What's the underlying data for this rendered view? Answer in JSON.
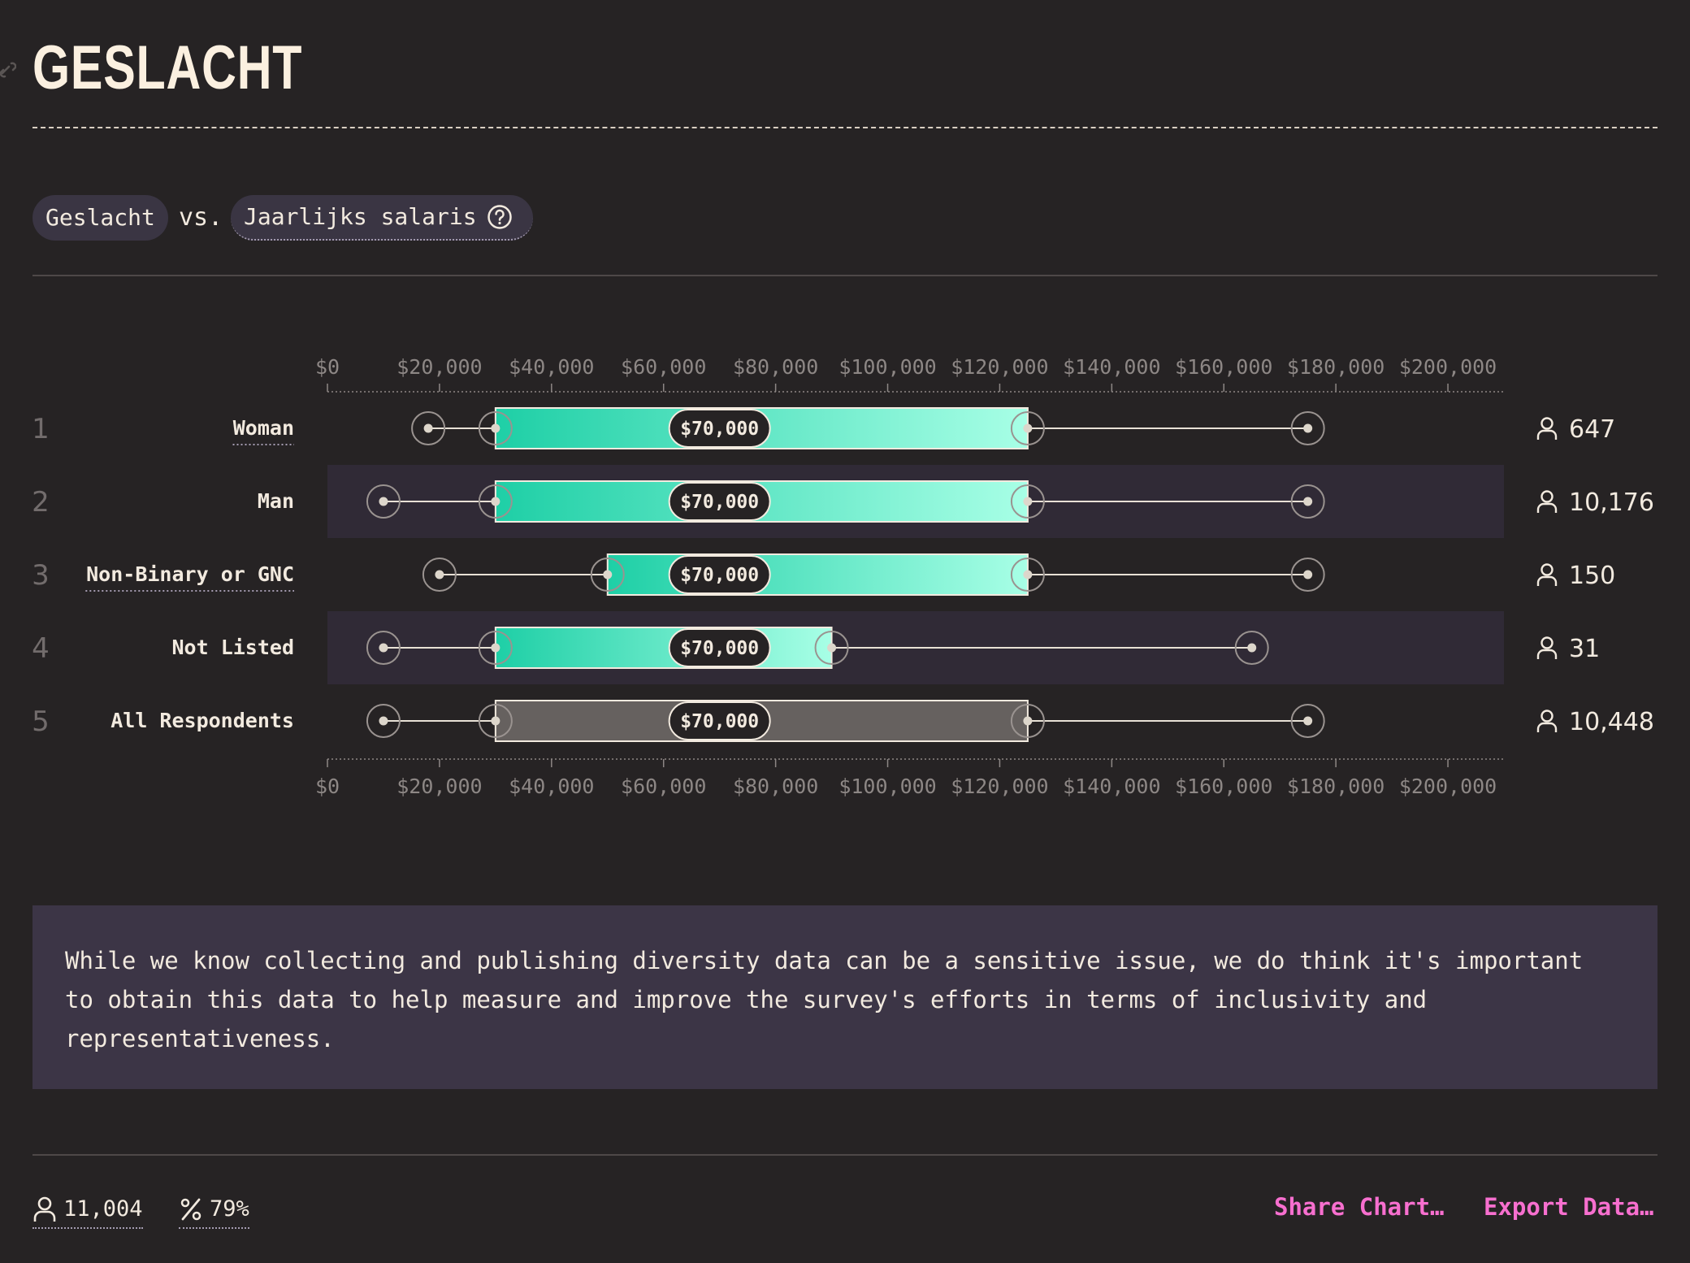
{
  "page": {
    "title": "GESLACHT",
    "filter_primary": "Geslacht",
    "filter_vs": "vs.",
    "filter_secondary": "Jaarlijks salaris",
    "note": "While we know collecting and publishing diversity data can be a sensitive issue, we do think it's important to obtain this data to help measure and improve the survey's efforts in terms of inclusivity and representativeness.",
    "total_respondents": "11,004",
    "completion_percent": "79%",
    "share_label": "Share Chart…",
    "export_label": "Export Data…",
    "icons": {
      "link": "link-icon",
      "help": "help-circle-icon",
      "person": "person-icon",
      "percent": "percent-icon"
    }
  },
  "chart_data": {
    "type": "boxplot",
    "title": "",
    "xlabel": "",
    "xlim": [
      0,
      210000
    ],
    "x_ticks": [
      0,
      20000,
      40000,
      60000,
      80000,
      100000,
      120000,
      140000,
      160000,
      180000,
      200000
    ],
    "x_tick_labels": [
      "$0",
      "$20,000",
      "$40,000",
      "$60,000",
      "$80,000",
      "$100,000",
      "$120,000",
      "$140,000",
      "$160,000",
      "$180,000",
      "$200,000"
    ],
    "categories": [
      {
        "rank": "1",
        "label": "Woman",
        "min": 18000,
        "q1": 30000,
        "median": 70000,
        "median_label": "$70,000",
        "q3": 125000,
        "max": 175000,
        "count": "647",
        "highlight": false
      },
      {
        "rank": "2",
        "label": "Man",
        "min": 10000,
        "q1": 30000,
        "median": 70000,
        "median_label": "$70,000",
        "q3": 125000,
        "max": 175000,
        "count": "10,176",
        "highlight": false
      },
      {
        "rank": "3",
        "label": "Non-Binary or GNC",
        "min": 20000,
        "q1": 50000,
        "median": 70000,
        "median_label": "$70,000",
        "q3": 125000,
        "max": 175000,
        "count": "150",
        "highlight": false
      },
      {
        "rank": "4",
        "label": "Not Listed",
        "min": 10000,
        "q1": 30000,
        "median": 70000,
        "median_label": "$70,000",
        "q3": 90000,
        "max": 165000,
        "count": "31",
        "highlight": false
      },
      {
        "rank": "5",
        "label": "All Respondents",
        "min": 10000,
        "q1": 30000,
        "median": 70000,
        "median_label": "$70,000",
        "q3": 125000,
        "max": 175000,
        "count": "10,448",
        "highlight": true
      }
    ],
    "colors": {
      "box_start": "#1ecfa6",
      "box_end": "#a8ffe6",
      "total_box": "#66615f",
      "row_band": "#302a36",
      "accent": "#f76fcf"
    },
    "grid": false,
    "legend": "none"
  }
}
